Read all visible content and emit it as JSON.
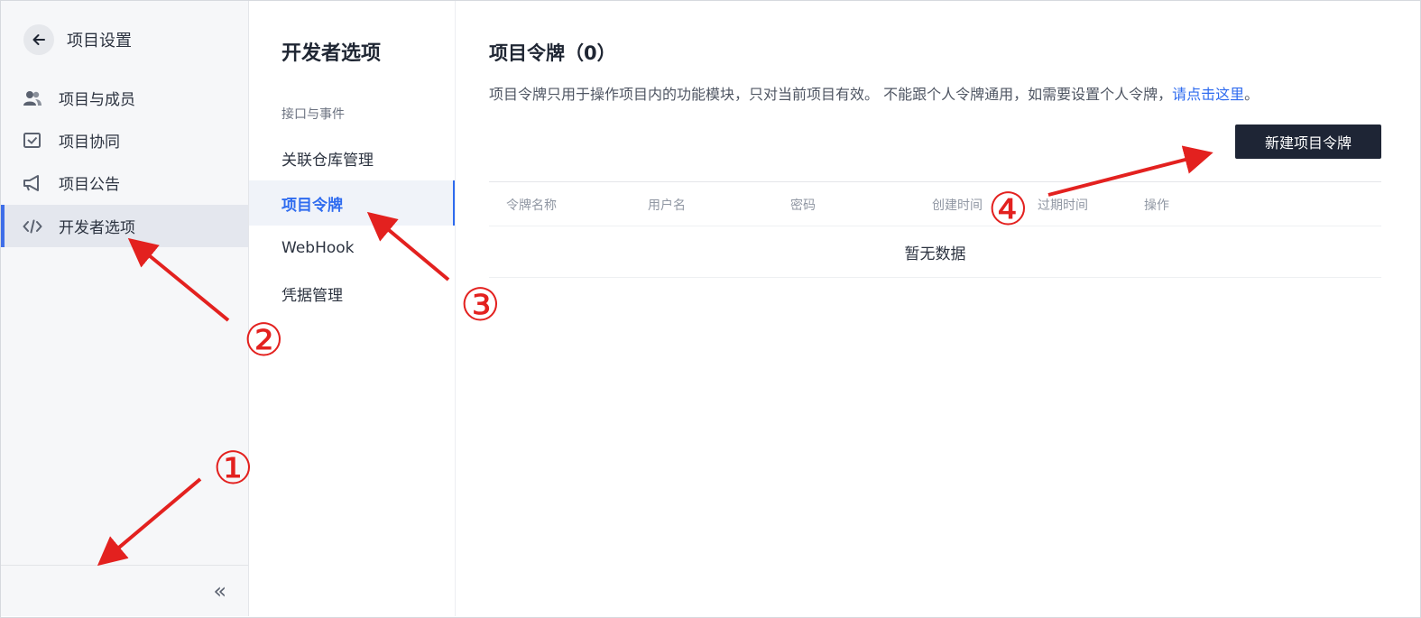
{
  "sidebar": {
    "back_title": "项目设置",
    "items": [
      {
        "label": "项目与成员",
        "icon": "members-icon"
      },
      {
        "label": "项目协同",
        "icon": "collab-icon"
      },
      {
        "label": "项目公告",
        "icon": "megaphone-icon"
      },
      {
        "label": "开发者选项",
        "icon": "code-icon",
        "active": true
      }
    ],
    "collapse_glyph": "«"
  },
  "subnav": {
    "title": "开发者选项",
    "group_label": "接口与事件",
    "items": [
      {
        "label": "关联仓库管理"
      },
      {
        "label": "项目令牌",
        "active": true
      },
      {
        "label": "WebHook"
      },
      {
        "label": "凭据管理"
      }
    ]
  },
  "main": {
    "title": "项目令牌（0）",
    "description": "项目令牌只用于操作项目内的功能模块，只对当前项目有效。 不能跟个人令牌通用，如需要设置个人令牌，",
    "description_link": "请点击这里",
    "description_tail": "。",
    "new_button_label": "新建项目令牌",
    "table": {
      "columns": [
        "令牌名称",
        "用户名",
        "密码",
        "创建时间",
        "过期时间",
        "操作"
      ],
      "empty_text": "暂无数据"
    }
  },
  "annotations": {
    "markers": [
      "①",
      "②",
      "③",
      "④"
    ],
    "color": "#e3211f"
  },
  "colors": {
    "accent": "#2e6bef",
    "primary_button": "#1e2535",
    "sidebar_bg": "#f6f7f9"
  }
}
